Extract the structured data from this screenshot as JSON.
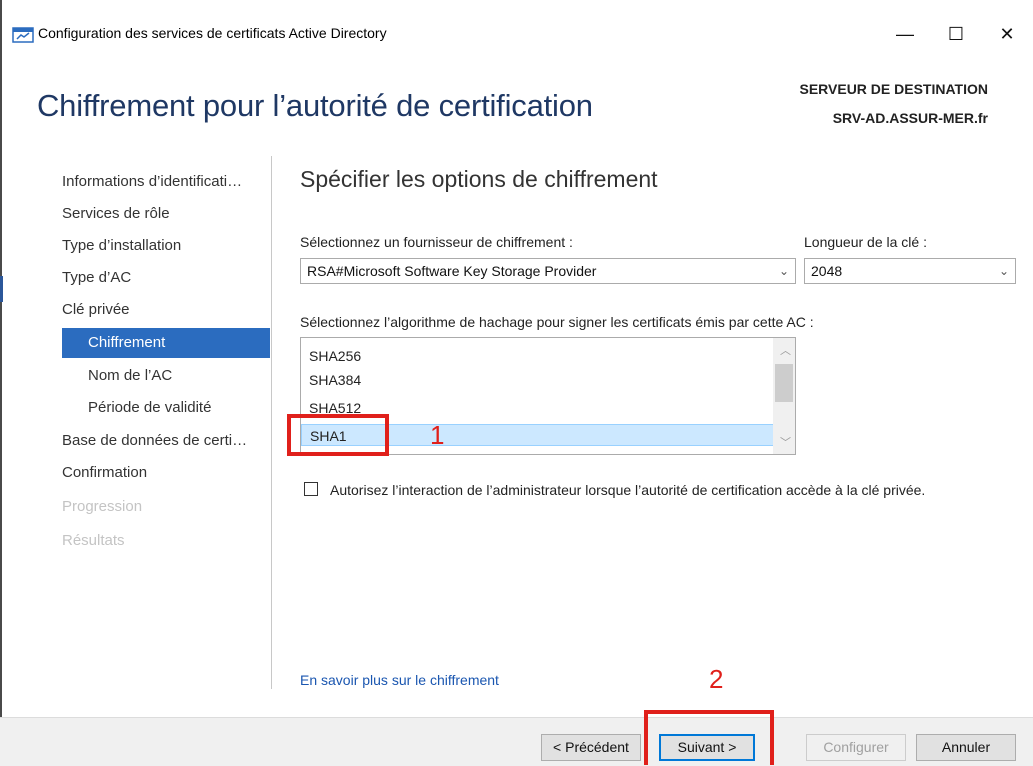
{
  "window": {
    "title": "Configuration des services de certificats Active Directory",
    "min_glyph": "—",
    "max_glyph": "☐",
    "close_glyph": "✕"
  },
  "header": {
    "page_title": "Chiffrement pour l’autorité de certification",
    "dest_label": "SERVEUR DE DESTINATION",
    "dest_server": "SRV-AD.ASSUR-MER.fr"
  },
  "sidebar": {
    "items": [
      {
        "label": "Informations d’identificati…",
        "state": "normal"
      },
      {
        "label": "Services de rôle",
        "state": "normal"
      },
      {
        "label": "Type d’installation",
        "state": "normal"
      },
      {
        "label": "Type d’AC",
        "state": "normal"
      },
      {
        "label": "Clé privée",
        "state": "normal"
      },
      {
        "label": "Chiffrement",
        "state": "selected"
      },
      {
        "label": "Nom de l’AC",
        "state": "sub"
      },
      {
        "label": "Période de validité",
        "state": "sub"
      },
      {
        "label": "Base de données de certi…",
        "state": "normal"
      },
      {
        "label": "Confirmation",
        "state": "normal"
      },
      {
        "label": "Progression",
        "state": "disabled"
      },
      {
        "label": "Résultats",
        "state": "disabled"
      }
    ]
  },
  "main": {
    "section_title": "Spécifier les options de chiffrement",
    "provider_label": "Sélectionnez un fournisseur de chiffrement :",
    "provider_value": "RSA#Microsoft Software Key Storage Provider",
    "key_length_label": "Longueur de la clé :",
    "key_length_value": "2048",
    "hash_label": "Sélectionnez l’algorithme de hachage pour signer les certificats émis par cette AC :",
    "hash_options": [
      "SHA256",
      "SHA384",
      "SHA512",
      "SHA1"
    ],
    "hash_selected": "SHA1",
    "admin_interaction_label": "Autorisez l’interaction de l’administrateur lorsque l’autorité de certification accède à la clé privée.",
    "admin_interaction_checked": false,
    "learn_more_link": "En savoir plus sur le chiffrement"
  },
  "footer": {
    "previous": "< Précédent",
    "next": "Suivant >",
    "configure": "Configurer",
    "cancel": "Annuler"
  },
  "annotations": {
    "step1": "1",
    "step2": "2",
    "color": "#e0201b"
  },
  "colors": {
    "accent": "#2b6cbf",
    "title": "#1f3864",
    "link": "#1a56b0",
    "selection": "#cce8ff"
  }
}
